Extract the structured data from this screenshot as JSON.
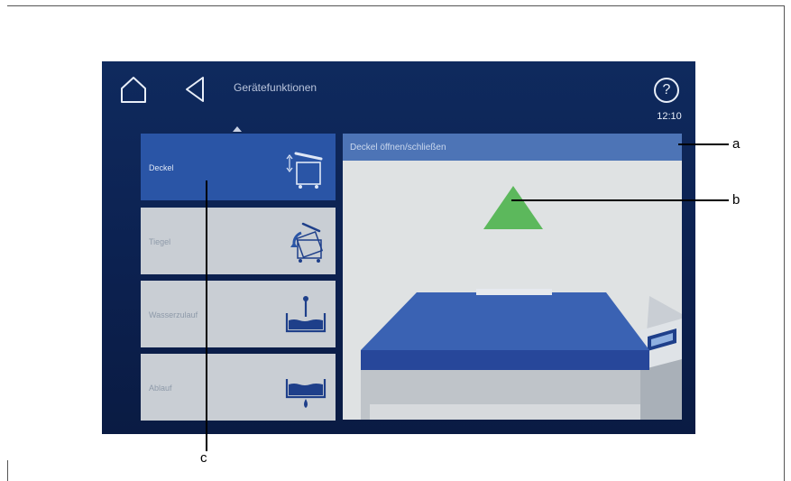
{
  "header": {
    "title": "Gerätefunktionen",
    "help_symbol": "?",
    "time": "12:10",
    "home_icon": "home-icon",
    "back_icon": "back-triangle-icon"
  },
  "menu": {
    "items": [
      {
        "label": "Deckel",
        "icon": "lid-open-close-icon",
        "active": true
      },
      {
        "label": "Tiegel",
        "icon": "pan-tilt-icon",
        "active": false
      },
      {
        "label": "Wasserzulauf",
        "icon": "water-inlet-icon",
        "active": false
      },
      {
        "label": "Ablauf",
        "icon": "drain-icon",
        "active": false
      }
    ]
  },
  "panel": {
    "title": "Deckel öffnen/schließen",
    "action_icon": "triangle-up-icon"
  },
  "callouts": {
    "a": "a",
    "b": "b",
    "c": "c"
  },
  "colors": {
    "screen_bg": "#0c2150",
    "active_tile": "#2a55a6",
    "inactive_tile": "#c9ced4",
    "panel_header": "#4d74b6",
    "action_green": "#5cb85c"
  }
}
